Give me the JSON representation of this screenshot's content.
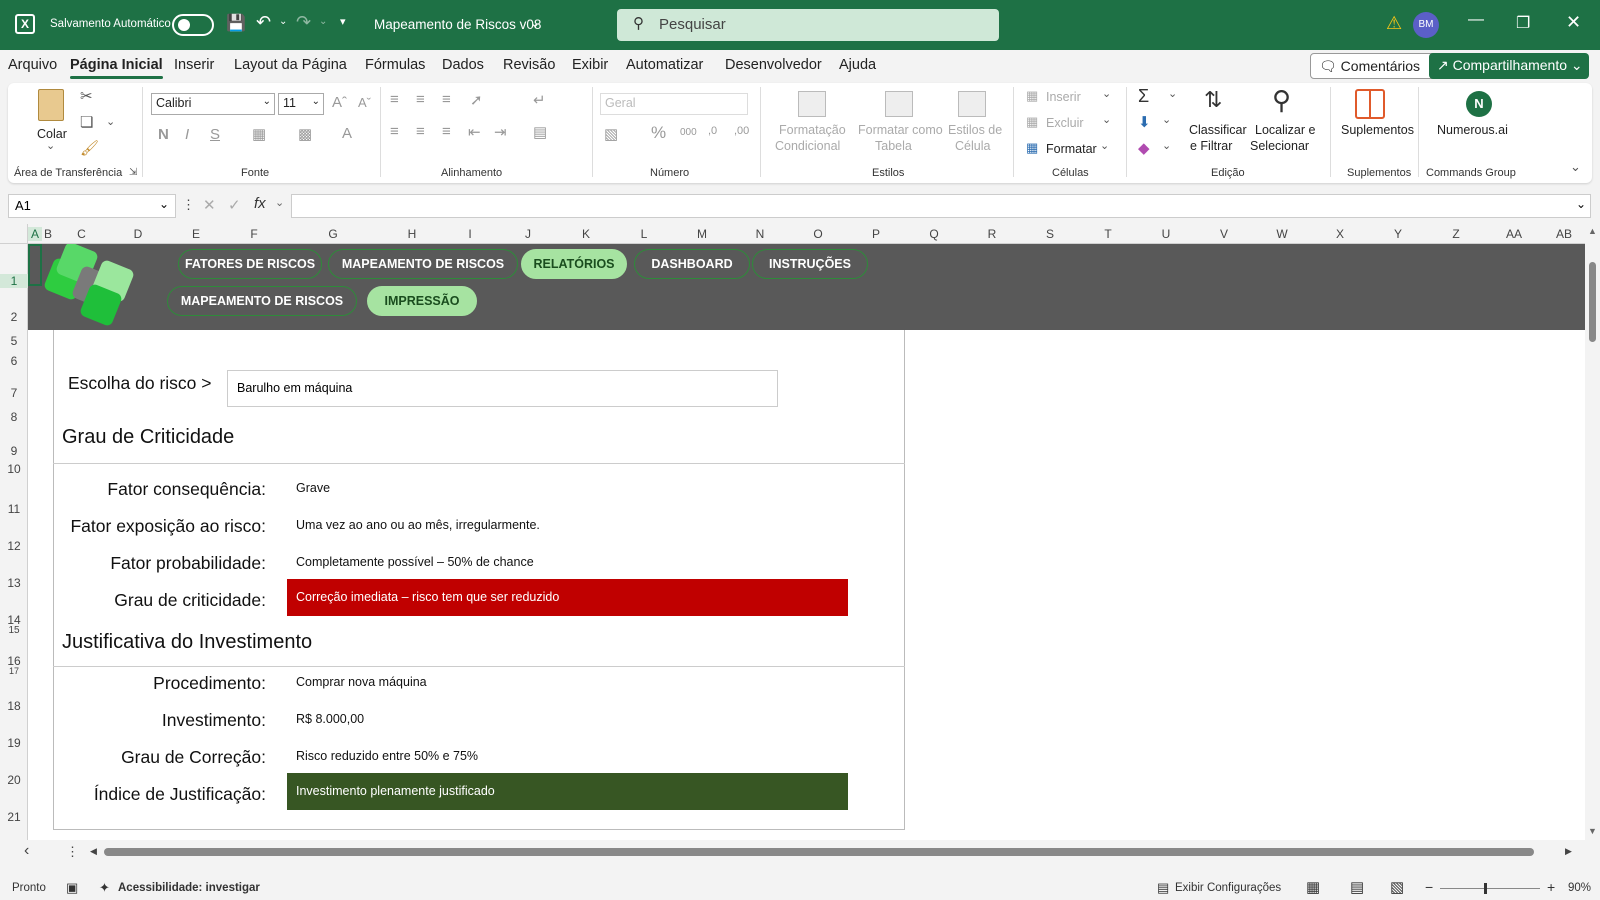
{
  "titlebar": {
    "autosave_label": "Salvamento Automático",
    "doc_title": "Mapeamento de Riscos v08",
    "search_placeholder": "Pesquisar",
    "user_initials": "BM"
  },
  "menu": {
    "items": [
      "Arquivo",
      "Página Inicial",
      "Inserir",
      "Layout da Página",
      "Fórmulas",
      "Dados",
      "Revisão",
      "Exibir",
      "Automatizar",
      "Desenvolvedor",
      "Ajuda"
    ],
    "comments_label": "Comentários",
    "share_label": "Compartilhamento"
  },
  "ribbon": {
    "paste_label": "Colar",
    "clipboard_group": "Área de Transferência",
    "font_name": "Calibri",
    "font_size": "11",
    "font_group": "Fonte",
    "alignment_group": "Alinhamento",
    "number_format": "Geral",
    "number_group": "Número",
    "cond_format_1": "Formatação",
    "cond_format_2": "Condicional",
    "format_table_1": "Formatar como",
    "format_table_2": "Tabela",
    "cell_styles_1": "Estilos de",
    "cell_styles_2": "Célula",
    "styles_group": "Estilos",
    "insert_label": "Inserir",
    "delete_label": "Excluir",
    "format_label": "Formatar",
    "cells_group": "Células",
    "sort_1": "Classificar",
    "sort_2": "e Filtrar",
    "find_1": "Localizar e",
    "find_2": "Selecionar",
    "editing_group": "Edição",
    "addins_label": "Suplementos",
    "addins_group": "Suplementos",
    "numerous_label": "Numerous.ai",
    "commands_group": "Commands Group"
  },
  "formula_bar": {
    "cell_ref": "A1",
    "content": ""
  },
  "grid": {
    "columns": [
      "A",
      "B",
      "C",
      "D",
      "E",
      "F",
      "G",
      "H",
      "I",
      "J",
      "K",
      "L",
      "M",
      "N",
      "O",
      "P",
      "Q",
      "R",
      "S",
      "T",
      "U",
      "V",
      "W",
      "X",
      "Y",
      "Z",
      "AA",
      "AB"
    ],
    "rows": [
      "1",
      "2",
      "5",
      "6",
      "7",
      "8",
      "9",
      "10",
      "11",
      "12",
      "13",
      "14",
      "15",
      "16",
      "17",
      "18",
      "19",
      "20",
      "21"
    ]
  },
  "nav": {
    "row1": [
      "FATORES DE RISCOS",
      "MAPEAMENTO DE RISCOS",
      "RELATÓRIOS",
      "DASHBOARD",
      "INSTRUÇÕES"
    ],
    "row2": [
      "MAPEAMENTO DE RISCOS",
      "IMPRESSÃO"
    ],
    "active_row1": "RELATÓRIOS",
    "active_row2": "IMPRESSÃO"
  },
  "report": {
    "choose_label": "Escolha do risco >",
    "choose_value": "Barulho em máquina",
    "section1_title": "Grau de Criticidade",
    "consequence_label": "Fator consequência:",
    "consequence_value": "Grave",
    "exposure_label": "Fator exposição ao risco:",
    "exposure_value": "Uma vez ao ano ou ao mês, irregularmente.",
    "probability_label": "Fator probabilidade:",
    "probability_value": "Completamente possível – 50% de chance",
    "criticality_label": "Grau de criticidade:",
    "criticality_value": "Correção imediata – risco tem que ser reduzido",
    "criticality_color": "#c00000",
    "section2_title": "Justificativa do Investimento",
    "procedure_label": "Procedimento:",
    "procedure_value": "Comprar nova máquina",
    "investment_label": "Investimento:",
    "investment_value": "R$ 8.000,00",
    "correction_label": "Grau de Correção:",
    "correction_value": "Risco reduzido entre 50% e 75%",
    "justification_label": "Índice de Justificação:",
    "justification_value": "Investimento plenamente justificado",
    "justification_color": "#375623"
  },
  "status": {
    "ready": "Pronto",
    "accessibility": "Acessibilidade: investigar",
    "display_settings": "Exibir Configurações",
    "zoom": "90%"
  },
  "colors": {
    "brand_green": "#1e7145",
    "banner_gray": "#595959",
    "pill_active": "#a6e3a1"
  }
}
